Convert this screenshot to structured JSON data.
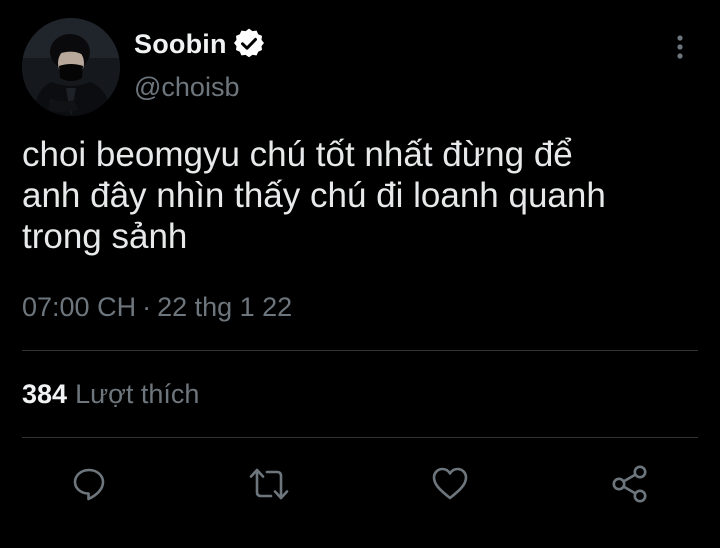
{
  "tweet": {
    "author": {
      "display_name": "Soobin",
      "handle": "@choisb",
      "verified": true,
      "avatar_icon": "profile-photo"
    },
    "text_lines": [
      "choi beomgyu chú tốt nhất đừng để",
      "anh đây nhìn thấy chú đi loanh quanh",
      "trong sảnh"
    ],
    "time": "07:00 CH",
    "separator": "·",
    "date": "22 thg 1 22",
    "likes": {
      "count": "384",
      "label": "Lượt thích"
    }
  },
  "actions": [
    {
      "name": "reply",
      "icon": "reply-icon"
    },
    {
      "name": "retweet",
      "icon": "retweet-icon"
    },
    {
      "name": "like",
      "icon": "heart-icon"
    },
    {
      "name": "share",
      "icon": "share-icon"
    }
  ],
  "colors": {
    "background": "#000000",
    "text": "#e7e9ea",
    "secondary_text": "#6e767d",
    "divider": "#2f3336",
    "verified_badge": "#ffffff"
  }
}
